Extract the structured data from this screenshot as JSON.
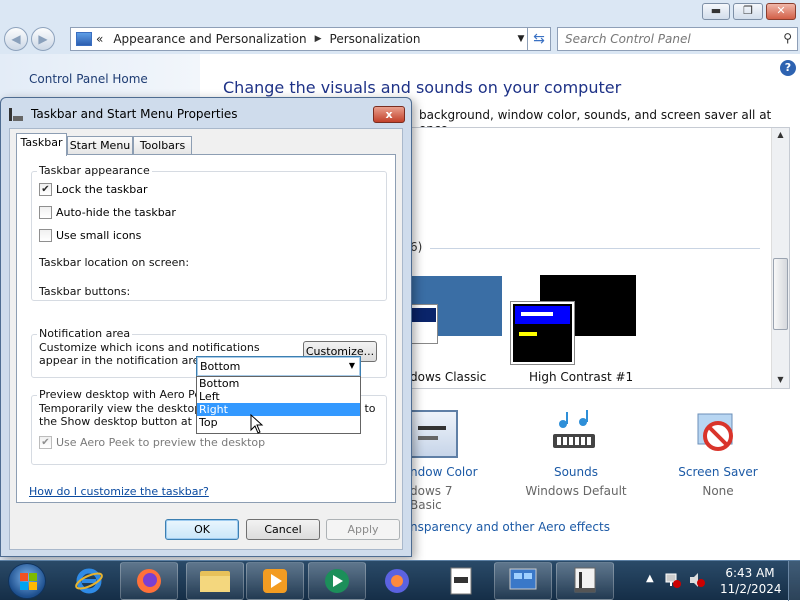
{
  "explorer": {
    "breadcrumb_prefix": "«",
    "breadcrumb": [
      "Appearance and Personalization",
      "Personalization"
    ],
    "search_placeholder": "Search Control Panel",
    "left_link": "Control Panel Home",
    "heading": "Change the visuals and sounds on your computer",
    "description": "background, window color, sounds, and screen saver all at once.",
    "group_count_fragment": "6)",
    "themes": [
      {
        "name": "dows Classic"
      },
      {
        "name": "High Contrast #1"
      }
    ],
    "items": [
      {
        "label": "ndow Color",
        "sub": "dows 7 Basic"
      },
      {
        "label": "Sounds",
        "sub": "Windows Default"
      },
      {
        "label": "Screen Saver",
        "sub": "None"
      }
    ],
    "aero_link": "nsparency and other Aero effects"
  },
  "dialog": {
    "title": "Taskbar and Start Menu Properties",
    "close": "x",
    "tabs": [
      "Taskbar",
      "Start Menu",
      "Toolbars"
    ],
    "active_tab": "Taskbar",
    "appearance": {
      "title": "Taskbar appearance",
      "lock": {
        "label": "Lock the taskbar",
        "checked": true
      },
      "autohide": {
        "label": "Auto-hide the taskbar",
        "checked": false
      },
      "small_icons": {
        "label": "Use small icons",
        "checked": false
      },
      "location_label": "Taskbar location on screen:",
      "location_value": "Bottom",
      "location_options": [
        "Bottom",
        "Left",
        "Right",
        "Top"
      ],
      "location_highlighted": "Right",
      "buttons_label": "Taskbar buttons:"
    },
    "notification": {
      "title": "Notification area",
      "text": "Customize which icons and notifications appear in the notification area.",
      "button": "Customize..."
    },
    "peek": {
      "title": "Preview desktop with Aero Peek",
      "text": "Temporarily view the desktop when you move your mouse to the Show desktop button at end of the taskbar.",
      "checkbox": {
        "label": "Use Aero Peek to preview the desktop",
        "checked": true,
        "enabled": false
      }
    },
    "help_link": "How do I customize the taskbar?",
    "buttons": {
      "ok": "OK",
      "cancel": "Cancel",
      "apply": "Apply"
    }
  },
  "taskbar": {
    "time": "6:43 AM",
    "date": "11/2/2024",
    "pinned": [
      "internet-explorer",
      "firefox",
      "file-explorer",
      "media-player",
      "media-center",
      "firefox-browser",
      "documents",
      "control-panel",
      "taskbar-properties"
    ]
  },
  "colors": {
    "accent_link": "#0a4aa0",
    "heading": "#1e3287",
    "selection": "#3399ff"
  }
}
